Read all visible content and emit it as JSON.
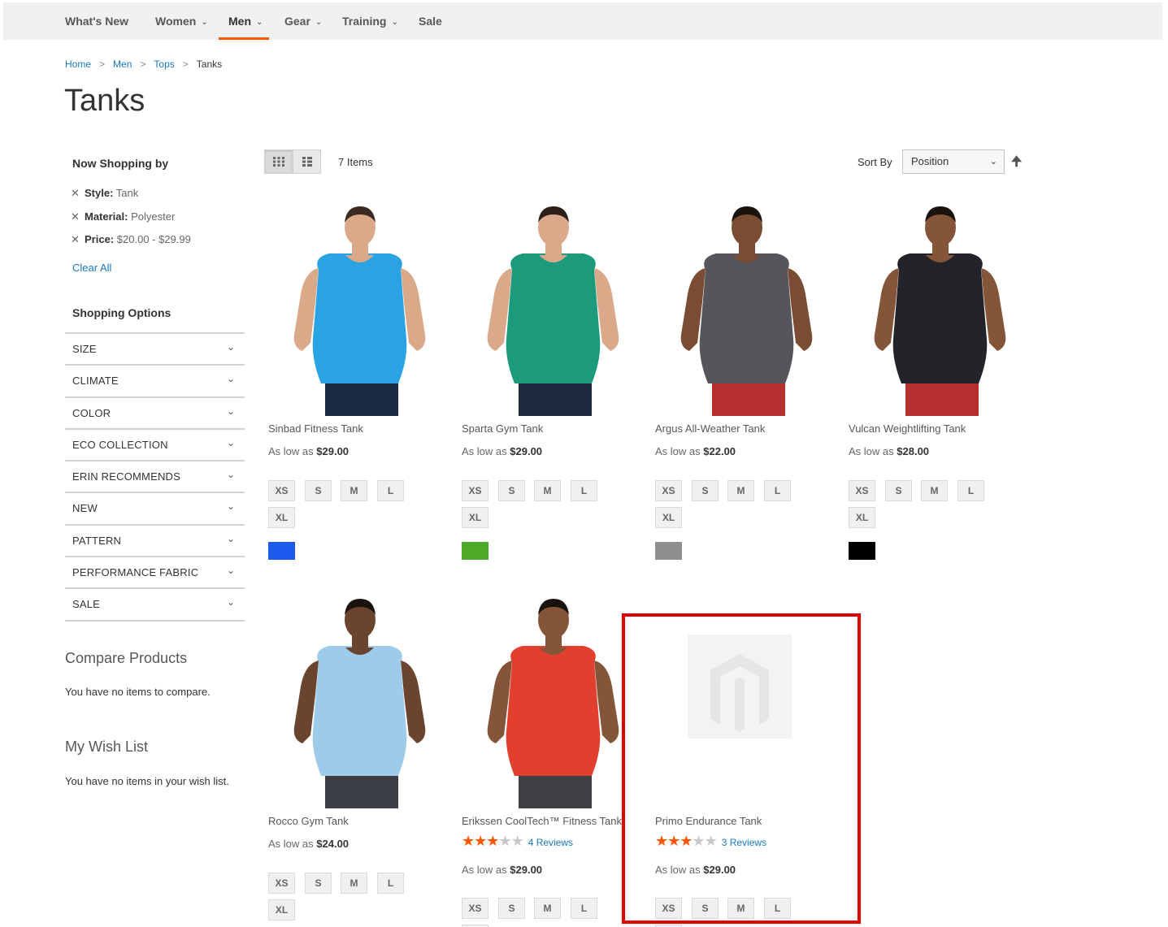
{
  "nav": {
    "items": [
      {
        "label": "What's New",
        "chevron": false
      },
      {
        "label": "Women",
        "chevron": true
      },
      {
        "label": "Men",
        "chevron": true,
        "active": true
      },
      {
        "label": "Gear",
        "chevron": true
      },
      {
        "label": "Training",
        "chevron": true
      },
      {
        "label": "Sale",
        "chevron": false
      }
    ]
  },
  "breadcrumbs": {
    "home": "Home",
    "men": "Men",
    "tops": "Tops",
    "current": "Tanks",
    "separator": ">"
  },
  "page_title": "Tanks",
  "filters": {
    "title": "Now Shopping by",
    "current": [
      {
        "label": "Style:",
        "value": "Tank"
      },
      {
        "label": "Material:",
        "value": "Polyester"
      },
      {
        "label": "Price:",
        "value": "$20.00 - $29.99"
      }
    ],
    "clear_all": "Clear All",
    "shopping_options": "Shopping Options",
    "options": [
      "SIZE",
      "CLIMATE",
      "COLOR",
      "ECO COLLECTION",
      "ERIN RECOMMENDS",
      "NEW",
      "PATTERN",
      "PERFORMANCE FABRIC",
      "SALE"
    ]
  },
  "compare": {
    "title": "Compare Products",
    "text": "You have no items to compare."
  },
  "wishlist": {
    "title": "My Wish List",
    "text": "You have no items in your wish list."
  },
  "toolbar": {
    "amount": "7 Items",
    "sort_label": "Sort By",
    "sort_value": "Position",
    "sort_dir_icon": "arrow-up-icon"
  },
  "price_prefix": "As low as",
  "sizes": [
    "XS",
    "S",
    "M",
    "L",
    "XL"
  ],
  "products": [
    {
      "name": "Sinbad Fitness Tank",
      "price": "$29.00",
      "shirt_color": "#29a3e3",
      "shorts_color": "#1d2a45",
      "skin": "#d9a98a",
      "hair": "#3a2a20",
      "swatch": "#1c59ec"
    },
    {
      "name": "Sparta Gym Tank",
      "price": "$29.00",
      "shirt_color": "#1c9a7c",
      "shorts_color": "#1f2a3e",
      "skin": "#d9a98a",
      "hair": "#2d2018",
      "swatch": "#4caa28"
    },
    {
      "name": "Argus All-Weather Tank",
      "price": "$22.00",
      "shirt_color": "#55555b",
      "shorts_color": "#b7302f",
      "skin": "#7a4c33",
      "hair": "#1a120d",
      "swatch": "#8e8e8e"
    },
    {
      "name": "Vulcan Weightlifting Tank",
      "price": "$28.00",
      "shirt_color": "#23232a",
      "shorts_color": "#b7302f",
      "skin": "#845538",
      "hair": "#1a120d",
      "swatch": "#000000"
    },
    {
      "name": "Rocco Gym Tank",
      "price": "$24.00",
      "shirt_color": "#9fcbea",
      "shorts_color": "#3a3d44",
      "skin": "#6b4430",
      "hair": "#1a120d"
    },
    {
      "name": "Erikssen CoolTech™ Fitness Tank",
      "price": "$29.00",
      "shirt_color": "#e2402f",
      "shorts_color": "#3f3f44",
      "skin": "#845538",
      "hair": "#1a120d",
      "rating": 3,
      "reviews": "4 Reviews"
    },
    {
      "name": "Primo Endurance Tank",
      "price": "$29.00",
      "placeholder": true,
      "rating": 3,
      "reviews": "3 Reviews"
    }
  ]
}
